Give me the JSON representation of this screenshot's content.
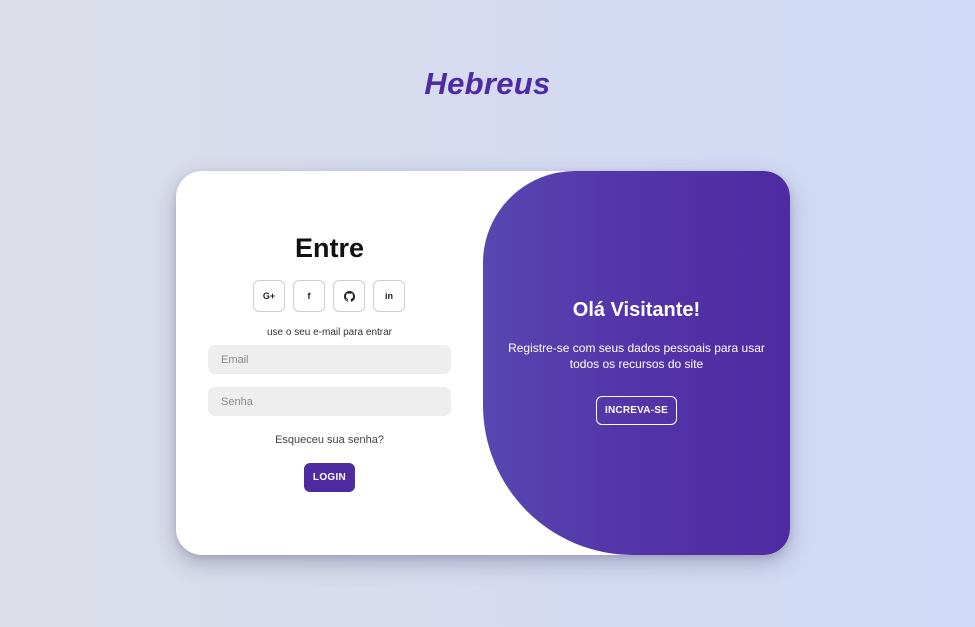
{
  "brand": {
    "name": "Hebreus"
  },
  "login": {
    "title": "Entre",
    "socials": [
      {
        "icon": "google-plus-icon",
        "label": "G+"
      },
      {
        "icon": "facebook-icon",
        "label": "f"
      },
      {
        "icon": "github-icon",
        "label": ""
      },
      {
        "icon": "linkedin-icon",
        "label": "in"
      }
    ],
    "hint": "use o seu e-mail para entrar",
    "email_placeholder": "Email",
    "password_placeholder": "Senha",
    "forgot": "Esqueceu sua senha?",
    "button": "LOGIN"
  },
  "welcome": {
    "title": "Olá Visitante!",
    "text": "Registre-se com seus dados pessoais para usar todos os recursos do site",
    "button": "INCREVA-SE"
  },
  "colors": {
    "accent": "#4e2ba1",
    "panel_gradient_start": "#5747b0",
    "panel_gradient_end": "#4f2aa2",
    "input_bg": "#eeeeee"
  }
}
